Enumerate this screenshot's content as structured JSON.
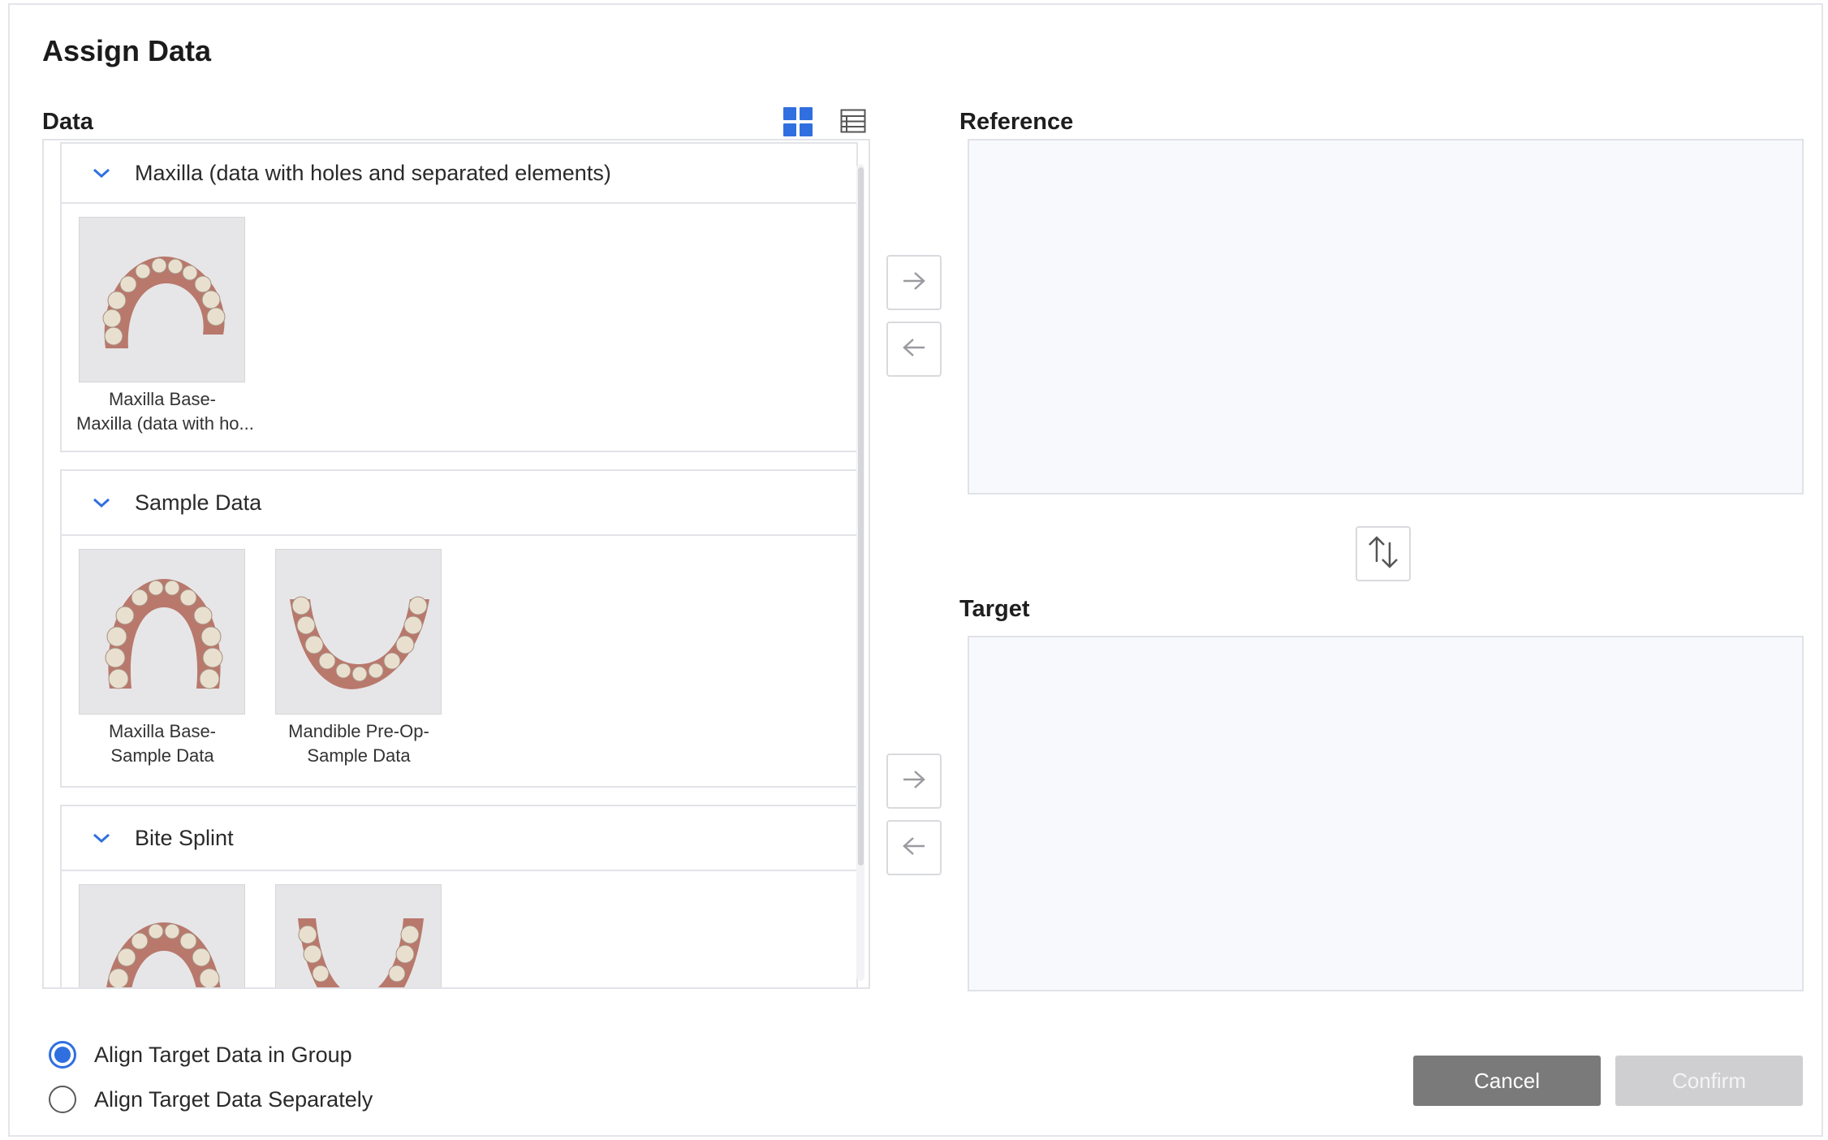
{
  "dialog": {
    "title": "Assign Data"
  },
  "data_panel": {
    "label": "Data",
    "groups": [
      {
        "title": "Maxilla (data with holes and separated elements)",
        "items": [
          {
            "line1": "Maxilla Base-",
            "line2": "Maxilla (data with ho...",
            "jaw": "maxilla"
          }
        ]
      },
      {
        "title": "Sample Data",
        "items": [
          {
            "line1": "Maxilla Base-",
            "line2": "Sample Data",
            "jaw": "maxilla"
          },
          {
            "line1": "Mandible Pre-Op-",
            "line2": "Sample Data",
            "jaw": "mandible"
          }
        ]
      },
      {
        "title": "Bite Splint",
        "items": [
          {
            "jaw": "maxilla"
          },
          {
            "jaw": "mandible"
          }
        ]
      }
    ]
  },
  "reference": {
    "label": "Reference"
  },
  "target": {
    "label": "Target"
  },
  "options": {
    "align_group": "Align Target Data in Group",
    "align_separately": "Align Target Data Separately",
    "selected": "align_group"
  },
  "footer": {
    "cancel_label": "Cancel",
    "confirm_label": "Confirm"
  },
  "colors": {
    "accent": "#2f6fe0",
    "cancel": "#7a7a7a",
    "confirm_disabled": "#cfcfd2",
    "drop_zone": "#f8f9fc"
  },
  "icons": [
    "grid-view-icon",
    "list-view-icon",
    "chevron-down-icon",
    "arrow-right-icon",
    "arrow-left-icon",
    "swap-vertical-icon"
  ]
}
